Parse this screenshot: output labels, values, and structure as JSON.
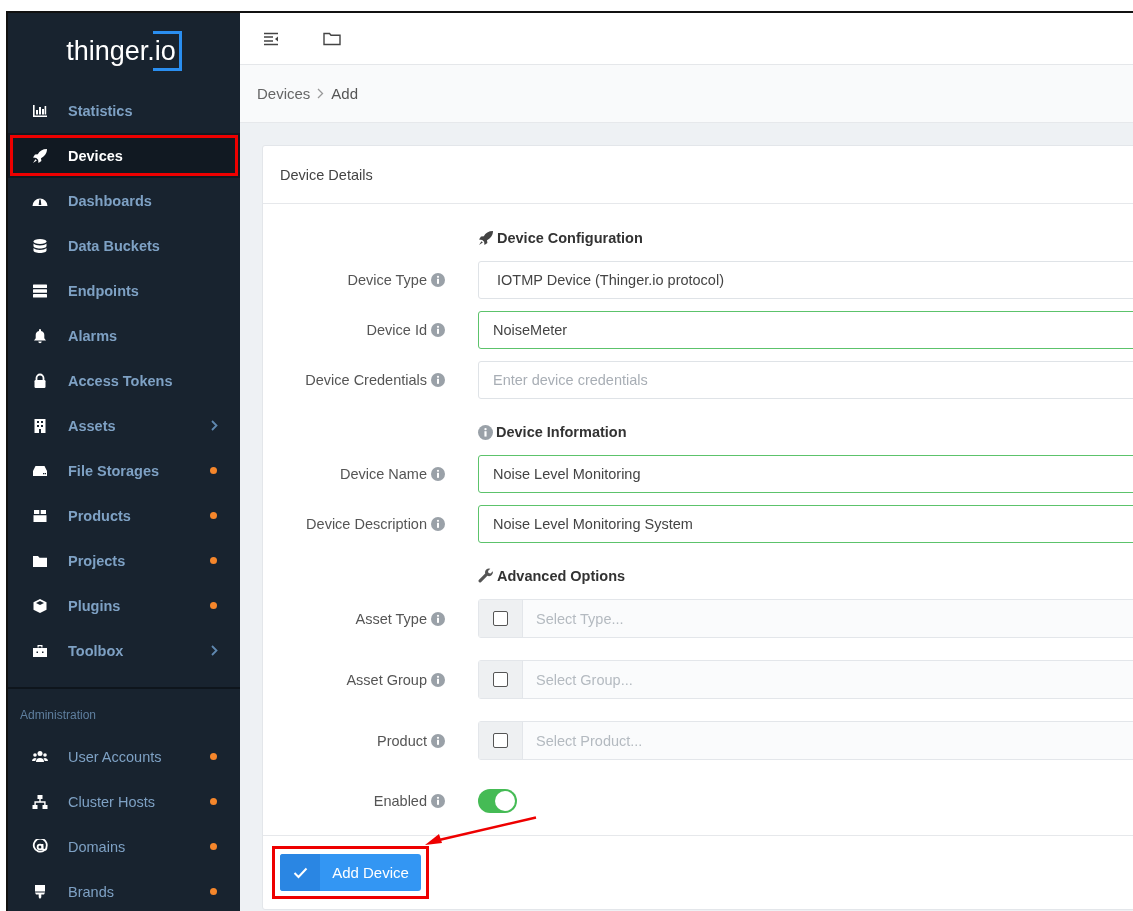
{
  "brand": {
    "name": "thinger.io"
  },
  "sidebar": {
    "groups": [
      {
        "items": [
          {
            "kind": "link",
            "label": "Statistics",
            "selected": false,
            "highlighted": false
          },
          {
            "kind": "link",
            "label": "Devices",
            "selected": true,
            "highlighted": true
          },
          {
            "kind": "link",
            "label": "Dashboards",
            "selected": false,
            "highlighted": false
          },
          {
            "kind": "link",
            "label": "Data Buckets",
            "selected": false,
            "highlighted": false
          },
          {
            "kind": "link",
            "label": "Endpoints",
            "selected": false,
            "highlighted": false
          },
          {
            "kind": "link",
            "label": "Alarms",
            "selected": false,
            "highlighted": false
          },
          {
            "kind": "link",
            "label": "Access Tokens",
            "selected": false,
            "highlighted": false
          },
          {
            "kind": "submenu",
            "label": "Assets",
            "selected": false,
            "highlighted": false
          },
          {
            "kind": "flagged",
            "label": "File Storages",
            "selected": false,
            "highlighted": false
          },
          {
            "kind": "flagged",
            "label": "Products",
            "selected": false,
            "highlighted": false
          },
          {
            "kind": "flagged",
            "label": "Projects",
            "selected": false,
            "highlighted": false
          },
          {
            "kind": "flagged",
            "label": "Plugins",
            "selected": false,
            "highlighted": false
          },
          {
            "kind": "submenu",
            "label": "Toolbox",
            "selected": false,
            "highlighted": false
          }
        ]
      },
      {
        "title": "Administration",
        "items": [
          {
            "kind": "flagged",
            "label": "User Accounts",
            "selected": false,
            "highlighted": false
          },
          {
            "kind": "flagged",
            "label": "Cluster Hosts",
            "selected": false,
            "highlighted": false
          },
          {
            "kind": "flagged",
            "label": "Domains",
            "selected": false,
            "highlighted": false
          },
          {
            "kind": "flagged",
            "label": "Brands",
            "selected": false,
            "highlighted": false
          }
        ]
      }
    ]
  },
  "breadcrumb": [
    "Devices",
    "Add"
  ],
  "card": {
    "title": "Device Details",
    "sections": [
      {
        "title": "Device Configuration",
        "fields": [
          {
            "kind": "select",
            "label": "Device Type",
            "value": "IOTMP Device (Thinger.io protocol)",
            "valid": false
          },
          {
            "kind": "text",
            "label": "Device Id",
            "value": "NoiseMeter",
            "valid": true
          },
          {
            "kind": "text",
            "label": "Device Credentials",
            "placeholder": "Enter device credentials",
            "valid": false
          }
        ]
      },
      {
        "title": "Device Information",
        "fields": [
          {
            "kind": "text",
            "label": "Device Name",
            "value": "Noise Level Monitoring",
            "valid": true
          },
          {
            "kind": "text",
            "label": "Device Description",
            "value": "Noise Level Monitoring System",
            "valid": true
          }
        ]
      },
      {
        "title": "Advanced Options",
        "fields": [
          {
            "kind": "picker",
            "label": "Asset Type",
            "placeholder": "Select Type...",
            "checked": false
          },
          {
            "kind": "picker",
            "label": "Asset Group",
            "placeholder": "Select Group...",
            "checked": false
          },
          {
            "kind": "picker",
            "label": "Product",
            "placeholder": "Select Product...",
            "checked": false
          },
          {
            "kind": "toggle",
            "label": "Enabled",
            "on": true
          }
        ]
      }
    ],
    "submit": {
      "label": "Add Device",
      "highlighted": true,
      "arrow": true
    }
  }
}
